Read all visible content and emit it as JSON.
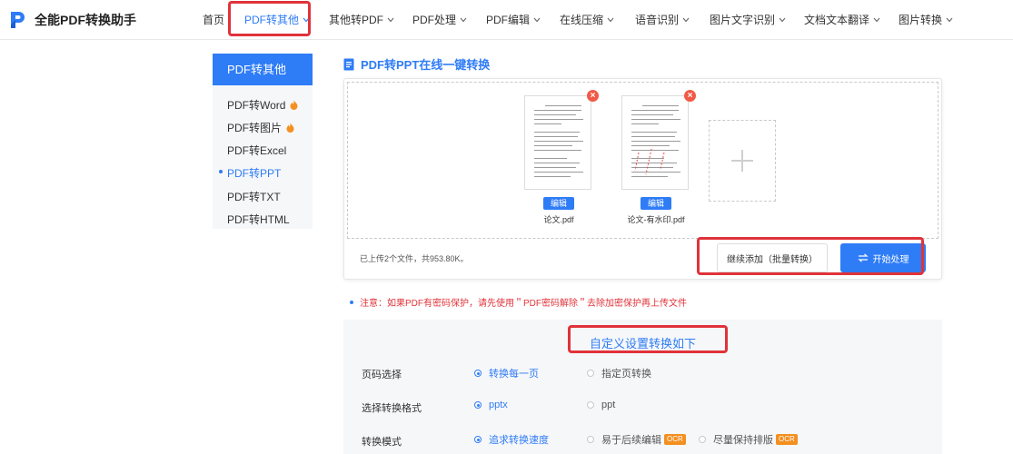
{
  "app": {
    "title": "全能PDF转换助手"
  },
  "nav": {
    "items": [
      {
        "label": "首页",
        "dropdown": false
      },
      {
        "label": "PDF转其他",
        "dropdown": true,
        "active": true
      },
      {
        "label": "其他转PDF",
        "dropdown": true
      },
      {
        "label": "PDF处理",
        "dropdown": true
      },
      {
        "label": "PDF编辑",
        "dropdown": true
      },
      {
        "label": "在线压缩",
        "dropdown": true
      },
      {
        "label": "语音识别",
        "dropdown": true
      },
      {
        "label": "图片文字识别",
        "dropdown": true
      },
      {
        "label": "文档文本翻译",
        "dropdown": true
      },
      {
        "label": "图片转换",
        "dropdown": true
      }
    ]
  },
  "sidebar": {
    "title": "PDF转其他",
    "items": [
      {
        "label": "PDF转Word",
        "hot": true
      },
      {
        "label": "PDF转图片",
        "hot": true
      },
      {
        "label": "PDF转Excel",
        "hot": false
      },
      {
        "label": "PDF转PPT",
        "hot": false,
        "active": true
      },
      {
        "label": "PDF转TXT",
        "hot": false
      },
      {
        "label": "PDF转HTML",
        "hot": false
      }
    ]
  },
  "main": {
    "title": "PDF转PPT在线一键转换",
    "files": [
      {
        "name": "论文.pdf",
        "edit_label": "编辑"
      },
      {
        "name": "论文-有水印.pdf",
        "edit_label": "编辑"
      }
    ],
    "upload_status": "已上传2个文件，共953.80K。",
    "continue_button": "继续添加（批量转换）",
    "start_button": "开始处理",
    "notice": "注意：如果PDF有密码保护，请先使用＂PDF密码解除＂去除加密保护再上传文件"
  },
  "settings": {
    "title": "自定义设置转换如下",
    "rows": [
      {
        "label": "页码选择",
        "options": [
          {
            "label": "转换每一页",
            "selected": true
          },
          {
            "label": "指定页转换",
            "selected": false
          }
        ]
      },
      {
        "label": "选择转换格式",
        "options": [
          {
            "label": "pptx",
            "selected": true
          },
          {
            "label": "ppt",
            "selected": false
          }
        ]
      },
      {
        "label": "转换模式",
        "options": [
          {
            "label": "追求转换速度",
            "selected": true
          },
          {
            "label": "易于后续编辑",
            "selected": false,
            "badge": "OCR"
          },
          {
            "label": "尽量保持排版",
            "selected": false,
            "badge": "OCR"
          }
        ]
      }
    ]
  },
  "colors": {
    "accent": "#2e7cf6",
    "highlight": "#e0333a",
    "badge": "#f39021"
  },
  "icons": [
    "logo-icon",
    "chevron-down-icon",
    "flame-icon",
    "document-icon",
    "close-icon",
    "plus-icon",
    "swap-icon"
  ]
}
